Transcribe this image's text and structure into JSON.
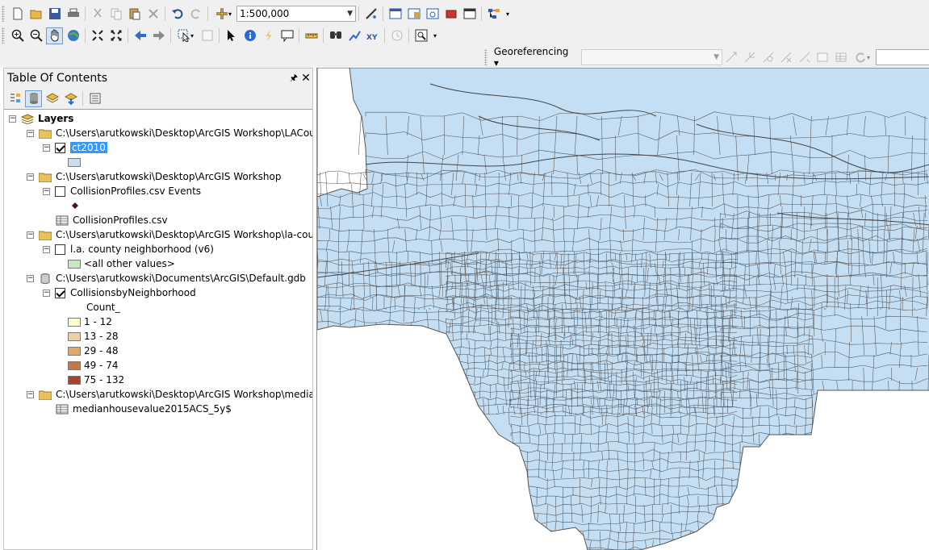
{
  "toolbar": {
    "scale_value": "1:500,000",
    "georef_label": "Georeferencing ▾",
    "icons": [
      "new-icon",
      "open-icon",
      "save-icon",
      "print-icon",
      "cut-icon",
      "copy-icon",
      "paste-icon",
      "delete-icon",
      "undo-icon",
      "redo-icon",
      "add-data-icon",
      "zoom-in-icon",
      "zoom-out-icon",
      "pan-icon",
      "full-extent-icon",
      "back-icon",
      "forward-icon",
      "select-icon",
      "identify-icon",
      "find-icon",
      "go-to-xy-icon"
    ]
  },
  "toc": {
    "title": "Table Of Contents",
    "pin_glyph": "⬇",
    "close_glyph": "✕",
    "layers_root": "Layers",
    "items": [
      {
        "label": "C:\\Users\\arutkowski\\Desktop\\ArcGIS Workshop\\LACountyC"
      },
      {
        "label": "ct2010"
      },
      {
        "label": "C:\\Users\\arutkowski\\Desktop\\ArcGIS Workshop"
      },
      {
        "label": "CollisionProfiles.csv Events"
      },
      {
        "label": "CollisionProfiles.csv"
      },
      {
        "label": "C:\\Users\\arutkowski\\Desktop\\ArcGIS Workshop\\la-county-r"
      },
      {
        "label": "l.a. county neighborhood (v6)"
      },
      {
        "label": "<all other values>"
      },
      {
        "label": "C:\\Users\\arutkowski\\Documents\\ArcGIS\\Default.gdb"
      },
      {
        "label": "CollisionsbyNeighborhood"
      },
      {
        "label": "Count_"
      },
      {
        "label": "1 - 12"
      },
      {
        "label": "13 - 28"
      },
      {
        "label": "29 - 48"
      },
      {
        "label": "49 - 74"
      },
      {
        "label": "75 - 132"
      },
      {
        "label": "C:\\Users\\arutkowski\\Desktop\\ArcGIS Workshop\\medianhou"
      },
      {
        "label": "medianhousevalue2015ACS_5y$"
      }
    ],
    "classes_colors": [
      "#ffffcc",
      "#f1cfa0",
      "#e0a86b",
      "#c9763e",
      "#a8442c"
    ],
    "fill_color": "#bee8ff"
  },
  "map": {
    "fill_color": "#c4def3",
    "line_color": "#555555"
  }
}
